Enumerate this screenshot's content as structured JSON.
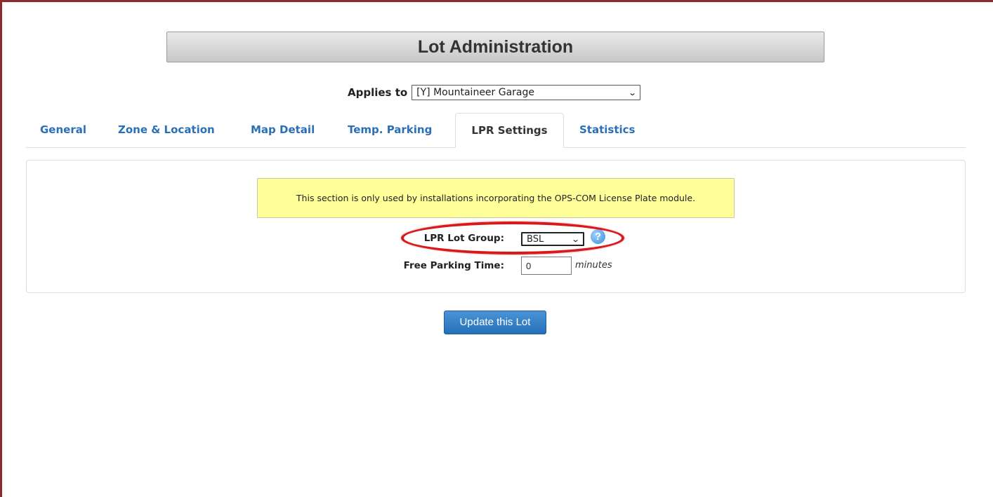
{
  "header": {
    "title": "Lot Administration"
  },
  "applies_to": {
    "label": "Applies to",
    "selected": "[Y] Mountaineer Garage"
  },
  "tabs": [
    {
      "label": "General"
    },
    {
      "label": "Zone & Location"
    },
    {
      "label": "Map Detail"
    },
    {
      "label": "Temp. Parking"
    },
    {
      "label": "LPR Settings",
      "active": true
    },
    {
      "label": "Statistics"
    }
  ],
  "panel": {
    "notice": "This section is only used by installations incorporating the OPS-COM License Plate module.",
    "lpr_group": {
      "label": "LPR Lot Group:",
      "selected": "BSL"
    },
    "help_icon": "?",
    "free_parking": {
      "label": "Free Parking Time:",
      "value": "0",
      "unit": "minutes"
    }
  },
  "actions": {
    "update_label": "Update this Lot"
  },
  "colors": {
    "accent": "#2a6fb8",
    "highlight": "#d8191c",
    "notice_bg": "#ffff99",
    "frame": "#8e2a2a"
  },
  "icons": {
    "help": "help-circle-icon",
    "chevron": "chevron-down-icon"
  }
}
